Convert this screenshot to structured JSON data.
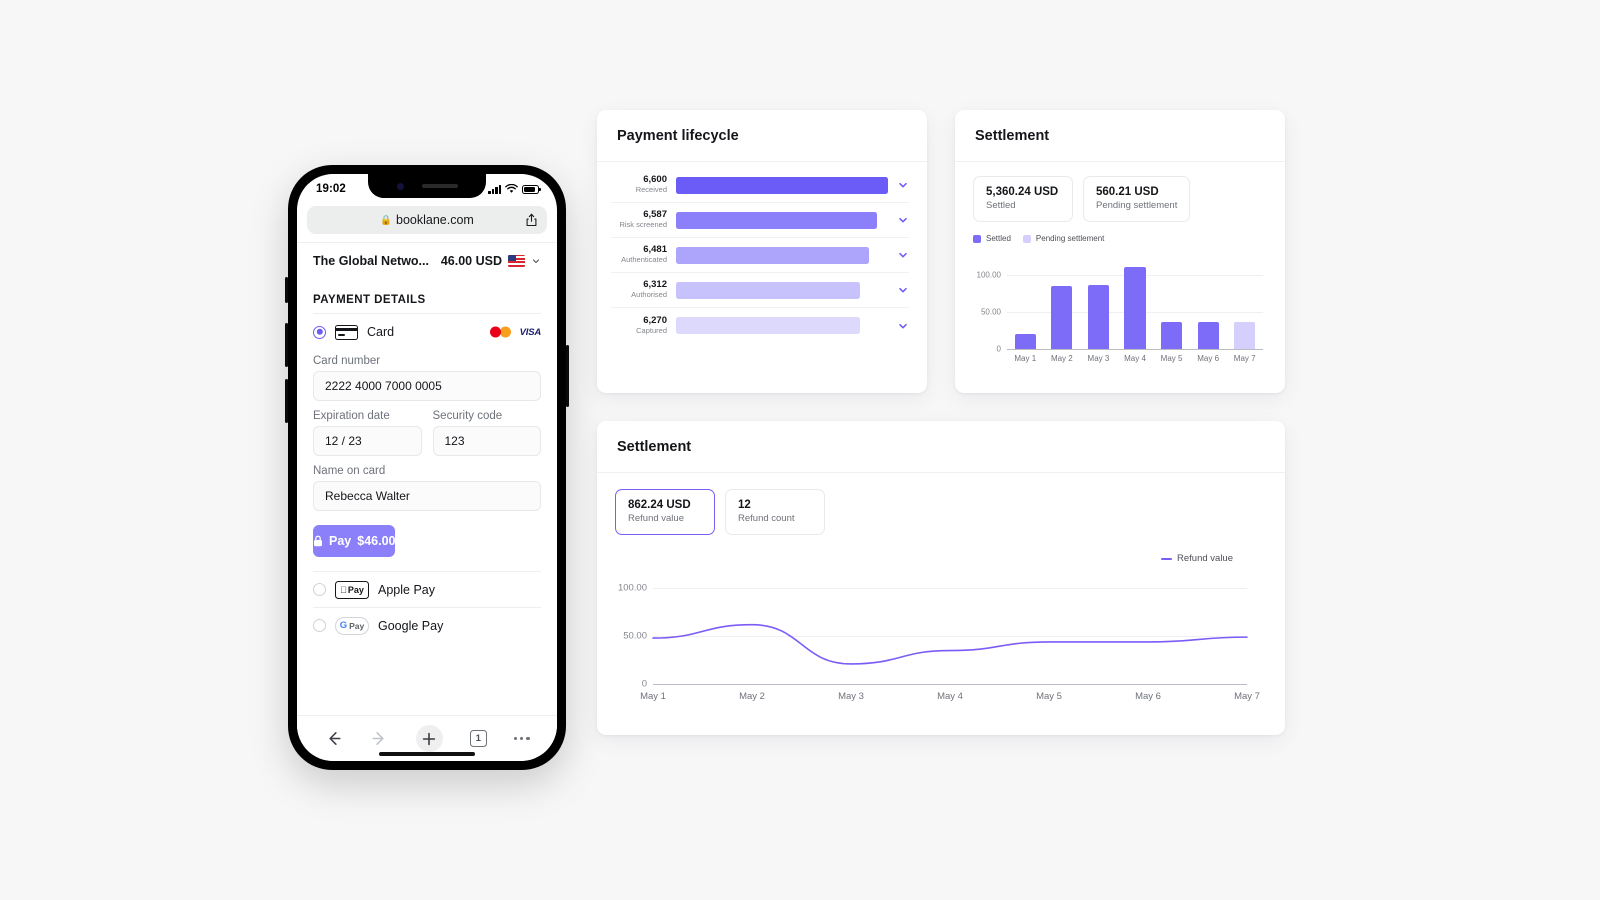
{
  "accent": {
    "primary": "#6C5CF7",
    "button": "#8B80F9",
    "selected_border": "#7C5CF7",
    "light": "#DDD9FD"
  },
  "phone": {
    "status": {
      "time": "19:02",
      "signal_icon": "signal-bars-icon",
      "wifi_icon": "wifi-icon",
      "battery_icon": "battery-icon"
    },
    "browser": {
      "url": "booklane.com",
      "lock_icon": "lock-icon",
      "share_icon": "share-icon",
      "back_icon": "arrow-left-icon",
      "forward_icon": "arrow-right-icon",
      "new_tab_icon": "plus-icon",
      "tab_count": "1",
      "more_icon": "more-dots-icon"
    },
    "merchant": {
      "name": "The Global Netwo...",
      "amount": "46.00 USD",
      "flag_icon": "us-flag-icon",
      "expand_icon": "chevron-down-icon"
    },
    "checkout": {
      "section_title": "PAYMENT DETAILS",
      "card_method_label": "Card",
      "card_icon": "credit-card-icon",
      "brands": [
        "mastercard-logo",
        "visa-logo"
      ],
      "visa_text": "VISA",
      "fields": {
        "card_number_label": "Card number",
        "card_number_value": "2222 4000 7000 0005",
        "expiry_label": "Expiration date",
        "expiry_value": "12 / 23",
        "cvc_label": "Security code",
        "cvc_value": "123",
        "name_label": "Name on card",
        "name_value": "Rebecca Walter"
      },
      "pay_button": {
        "label": "Pay",
        "amount": "$46.00",
        "icon": "lock-icon"
      },
      "alt_methods": [
        {
          "label": "Apple Pay",
          "badge": "Pay",
          "badge_icon": "apple-logo"
        },
        {
          "label": "Google Pay",
          "badge": "Pay",
          "badge_icon": "google-g-logo"
        }
      ]
    }
  },
  "lifecycle_card": {
    "title": "Payment lifecycle",
    "expand_icon": "chevron-down-icon",
    "rows": [
      {
        "count": "6,600",
        "stage": "Received",
        "pct": 100,
        "color": "#6C5CF7"
      },
      {
        "count": "6,587",
        "stage": "Risk screened",
        "pct": 95,
        "color": "#8B80F9"
      },
      {
        "count": "6,481",
        "stage": "Authenticated",
        "pct": 91,
        "color": "#ADA4FB"
      },
      {
        "count": "6,312",
        "stage": "Authorised",
        "pct": 87,
        "color": "#C8C2FC"
      },
      {
        "count": "6,270",
        "stage": "Captured",
        "pct": 87,
        "color": "#DDD9FD"
      }
    ]
  },
  "settlement_card": {
    "title": "Settlement",
    "tiles": [
      {
        "value": "5,360.24 USD",
        "caption": "Settled"
      },
      {
        "value": "560.21 USD",
        "caption": "Pending settlement"
      }
    ]
  },
  "refunds_card": {
    "title": "Settlement",
    "tiles": [
      {
        "value": "862.24 USD",
        "caption": "Refund value",
        "selected": true
      },
      {
        "value": "12",
        "caption": "Refund count",
        "selected": false
      }
    ]
  },
  "chart_data": [
    {
      "type": "bar",
      "title": "Settlement",
      "categories": [
        "May 1",
        "May 2",
        "May 3",
        "May 4",
        "May 5",
        "May 6",
        "May 7"
      ],
      "series": [
        {
          "name": "Settled",
          "color": "#7C6CF8",
          "values": [
            20,
            85,
            87,
            112,
            37,
            37,
            null
          ]
        },
        {
          "name": "Pending settlement",
          "color": "#D4CFFC",
          "values": [
            null,
            null,
            null,
            null,
            null,
            null,
            37
          ]
        }
      ],
      "legend": [
        "Settled",
        "Pending settlement"
      ],
      "legend_position": "top-left",
      "yticks": [
        "100.00",
        "50.00",
        "0"
      ],
      "ylim": [
        0,
        125
      ],
      "xlabel": "",
      "ylabel": "",
      "grid": true
    },
    {
      "type": "line",
      "title": "Settlement",
      "x": [
        "May 1",
        "May 2",
        "May 3",
        "May 4",
        "May 5",
        "May 6",
        "May 7"
      ],
      "series": [
        {
          "name": "Refund value",
          "color": "#7C5CF7",
          "values": [
            48,
            62,
            21,
            35,
            44,
            44,
            49
          ]
        }
      ],
      "legend": [
        "Refund value"
      ],
      "legend_position": "top-right",
      "yticks": [
        "100.00",
        "50.00",
        "0"
      ],
      "ylim": [
        0,
        115
      ],
      "xlabel": "",
      "ylabel": "",
      "grid": true
    }
  ]
}
